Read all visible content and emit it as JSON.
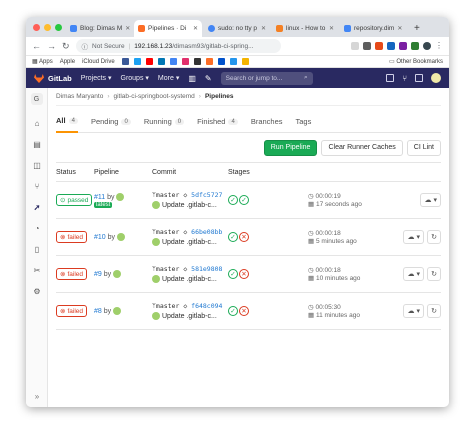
{
  "browser": {
    "tabs": [
      {
        "label": "Blog: Dimas M",
        "color": "#4286f5"
      },
      {
        "label": "Pipelines · Di",
        "color": "#fc6d26"
      },
      {
        "label": "sudo: no tty p",
        "color": "#4285f4"
      },
      {
        "label": "linux - How to",
        "color": "#f48024"
      },
      {
        "label": "repository.dim",
        "color": "#4286f5"
      }
    ],
    "new_tab": "+",
    "security": "Not Secure",
    "url_host": "192.168.1.23",
    "url_path": "/dimasm93/gitlab-ci-spring...",
    "bookmarks": [
      "Apps",
      "Apple",
      "iCloud Drive"
    ],
    "other_bookmarks": "Other Bookmarks"
  },
  "gitlab": {
    "brand": "GitLab",
    "menu": [
      "Projects ▾",
      "Groups ▾",
      "More ▾"
    ],
    "search_placeholder": "Search or jump to...",
    "search_key": "⌕"
  },
  "sidebar": {
    "project_initial": "G"
  },
  "breadcrumb": [
    "Dimas Maryanto",
    "gitlab-ci-springboot-systemd",
    "Pipelines"
  ],
  "tabs": [
    {
      "label": "All",
      "count": "4"
    },
    {
      "label": "Pending",
      "count": "0"
    },
    {
      "label": "Running",
      "count": "0"
    },
    {
      "label": "Finished",
      "count": "4"
    },
    {
      "label": "Branches",
      "count": ""
    },
    {
      "label": "Tags",
      "count": ""
    }
  ],
  "toolbar": {
    "run_pipeline": "Run Pipeline",
    "clear_cache": "Clear Runner Caches",
    "ci_lint": "CI Lint"
  },
  "table": {
    "headers": [
      "Status",
      "Pipeline",
      "Commit",
      "Stages"
    ],
    "rows": [
      {
        "status": "passed",
        "id": "#11",
        "by": "by",
        "latest": "latest",
        "branch": "master",
        "sha": "5dfc5727",
        "message": "Update .gitlab-c...",
        "stages": [
          "ok",
          "ok"
        ],
        "duration": "00:00:19",
        "finished": "17 seconds ago"
      },
      {
        "status": "failed",
        "id": "#10",
        "by": "by",
        "latest": "",
        "branch": "master",
        "sha": "66be08bb",
        "message": "Update .gitlab-c...",
        "stages": [
          "ok",
          "fail"
        ],
        "duration": "00:00:18",
        "finished": "5 minutes ago"
      },
      {
        "status": "failed",
        "id": "#9",
        "by": "by",
        "latest": "",
        "branch": "master",
        "sha": "581e9808",
        "message": "Update .gitlab-c...",
        "stages": [
          "ok",
          "fail"
        ],
        "duration": "00:00:18",
        "finished": "10 minutes ago"
      },
      {
        "status": "failed",
        "id": "#8",
        "by": "by",
        "latest": "",
        "branch": "master",
        "sha": "f648c094",
        "message": "Update .gitlab-c...",
        "stages": [
          "ok",
          "fail"
        ],
        "duration": "00:05:30",
        "finished": "11 minutes ago"
      }
    ]
  },
  "colors": {
    "gitlab_header": "#292961",
    "passed": "#1aaa55",
    "failed": "#db3b21",
    "link": "#1f78d1",
    "active_tab": "#fc9403"
  }
}
